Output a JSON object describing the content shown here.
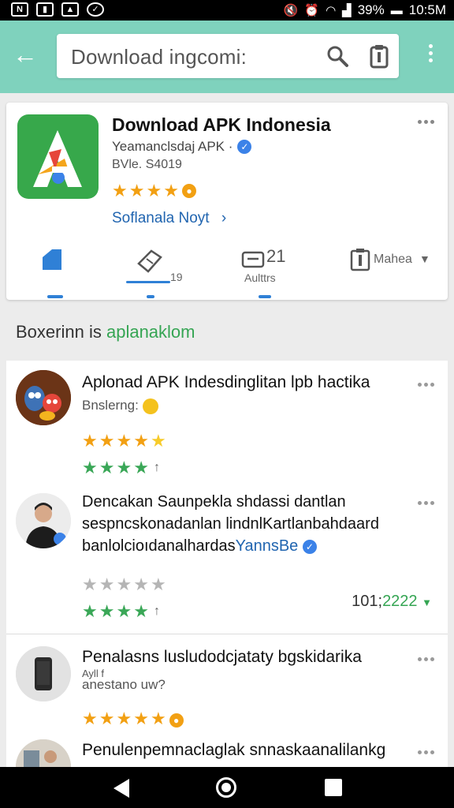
{
  "status_bar": {
    "battery": "39%",
    "time": "10:5M"
  },
  "search": {
    "query": "Download ingcomi:"
  },
  "app": {
    "title": "Download APK Indonesia",
    "developer": "Yeamanclsdaj APK ·",
    "version": "BVle. S4019",
    "link": "Soflanala Noyt",
    "link_arrow": "›",
    "colors": {
      "logo_bg": "#37a84b",
      "accent": "#2f80d6",
      "star": "#f2a013"
    },
    "actions": [
      {
        "icon": "bookmark-icon",
        "label": ""
      },
      {
        "icon": "tag-icon",
        "label": "19"
      },
      {
        "icon": "print-icon",
        "label": "Aulttrs",
        "value": "21"
      },
      {
        "icon": "clipboard-icon",
        "label": "Mahea"
      }
    ]
  },
  "section": {
    "title_prefix": "Boxerinn is",
    "title_accent": "aplanaklom"
  },
  "reviews": [
    {
      "avatar": "cartoon-avatar",
      "title": "Aplonad APK Indesdinglitan lpb hactika",
      "subtitle": "Bnslerng:",
      "stars_orange": 5,
      "stars_green": 4
    },
    {
      "avatar": "person-avatar",
      "lines": [
        "Dencakan Saunpekla shdassi dantlan",
        "sespncskonadanlan lindnlKartlanbahdaard",
        "banlolcioıdanalhardas"
      ],
      "link": "YannsBe",
      "stars_gray": 5,
      "stars_green": 4,
      "count": "101;",
      "count_accent": "2222"
    },
    {
      "avatar": "phone-avatar",
      "title": "Penalasns lusludodcjataty bgskidarika",
      "subtitle_small": "Ayll f",
      "subtitle": "anestano uw?",
      "stars_orange": 5
    },
    {
      "avatar": "photo-avatar",
      "title": "Penulenpemnaclaglak snnaskaanalilankg"
    }
  ]
}
